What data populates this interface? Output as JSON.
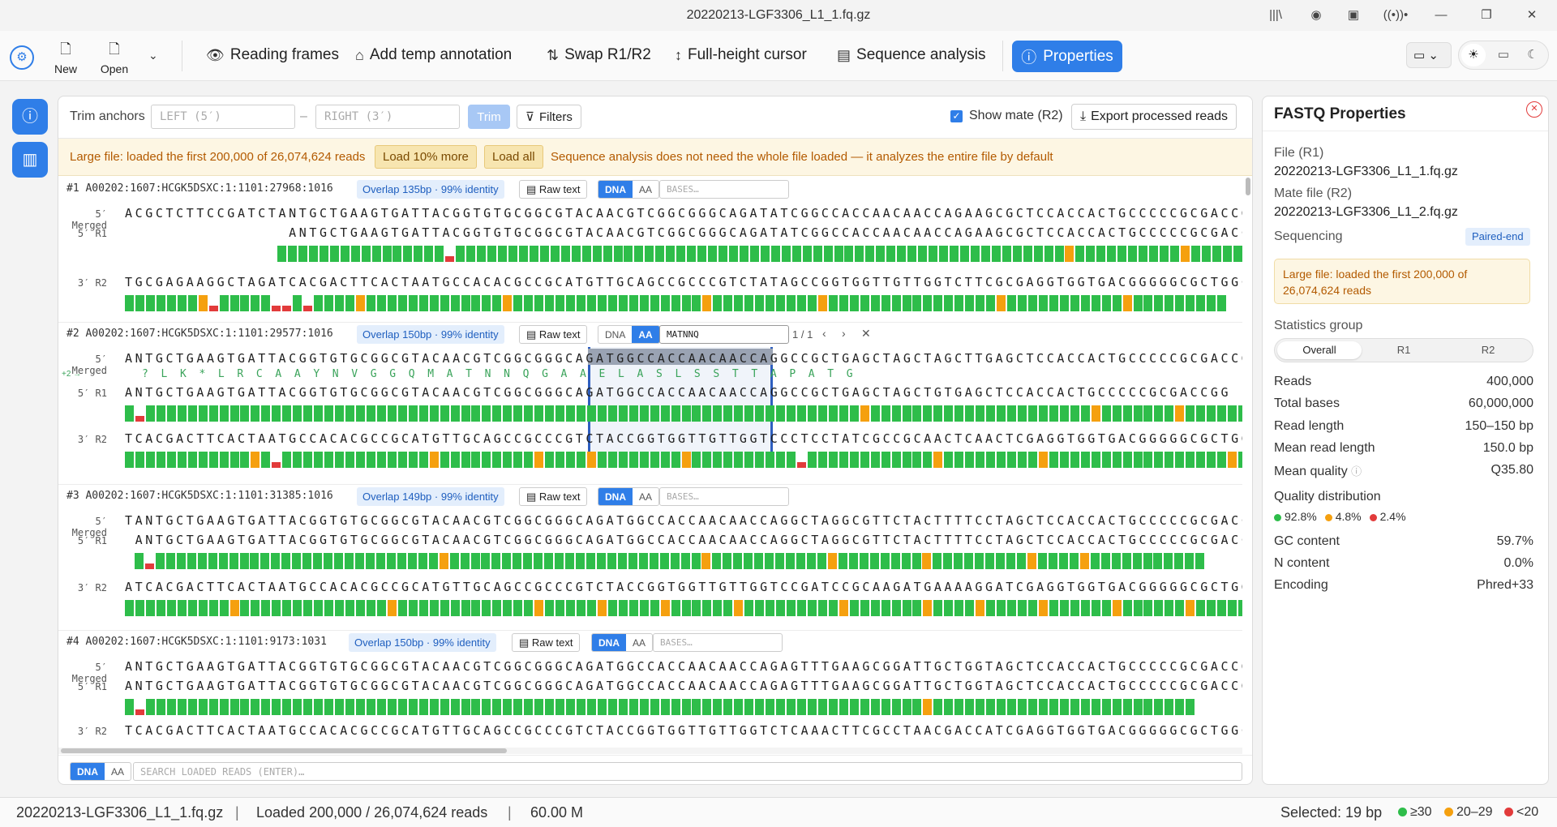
{
  "window": {
    "title": "20220213-LGF3306_L1_1.fq.gz"
  },
  "toolbar": {
    "new_label": "New",
    "open_label": "Open",
    "reading_frames": "Reading frames",
    "add_temp_annotation": "Add temp annotation",
    "swap": "Swap R1/R2",
    "full_height_cursor": "Full-height cursor",
    "sequence_analysis": "Sequence analysis",
    "properties": "Properties"
  },
  "trim": {
    "label": "Trim anchors",
    "left_placeholder": "LEFT (5′)",
    "dash": "–",
    "right_placeholder": "RIGHT (3′)",
    "trim_button": "Trim",
    "filters_button": "Filters",
    "show_mate": "Show mate (R2)",
    "export": "Export processed reads"
  },
  "banner": {
    "message": "Large file: loaded the first 200,000 of 26,074,624 reads",
    "load_more": "Load 10% more",
    "load_all": "Load all",
    "note": "Sequence analysis does not need the whole file loaded — it analyzes the entire file by default"
  },
  "read_labels": {
    "merged": "5′ Merged",
    "r1": "5′ R1",
    "r2": "3′ R2",
    "frame": "+2 →",
    "raw": "Raw text",
    "dna": "DNA",
    "aa": "AA",
    "bases_placeholder": "BASES…"
  },
  "reads": [
    {
      "id": "#1  A00202:1607:HCGK5DSXC:1:1101:27968:1016",
      "overlap": "Overlap 135bp · 99% identity",
      "merged": "ACGCTCTTCCGATCTANTGCTGAAGTGATTACGGTGTGCGGCGTACAACGTCGGCGGGCAGATATCGGCCACCAACAACCAGAAGCGCTCCACCACTGCCCCCGCGACCGG",
      "r1": "                ANTGCTGAAGTGATTACGGTGTGCGGCGTACAACGTCGGCGGGCAGATATCGGCCACCAACAACCAGAAGCGCTCCACCACTGCCCCCGCGACCGG",
      "r2": "TGCGAGAAGGCTAGATCACGACTTCACTAATGCCACACGCCGCATGTTGCAGCCGCCCGTCTATAGCCGGTGGTTGTTGGTCTTCGCGAGGTGGTGACGGGGGCGCTGGCC",
      "r1_quality": "................r..........................................................y..........y.................",
      "r2_quality": ".......yr.....rr.r....y.............y..................y..........y................y...........y........."
    },
    {
      "id": "#2  A00202:1607:HCGK5DSXC:1:1101:29577:1016",
      "overlap": "Overlap 150bp · 99% identity",
      "search_value": "MATNNQ",
      "match_count": "1 / 1",
      "merged": "ANTGCTGAAGTGATTACGGTGTGCGGCGTACAACGTCGGCGGGCAGATGGCCACCAACAACCAGGCCGCTGAGCTAGCTAGCTTGAGCTCCACCACTGCCCCCGCGACCGG",
      "translation": "?  L  K  *  L  R  C  A  A  Y  N  V  G  G  Q  M  A  T  N  N  Q  G  A  A  E  L  A  S  L  S  S  T  T  A  P  A  T  G",
      "r1": "ANTGCTGAAGTGATTACGGTGTGCGGCGTACAACGTCGGCGGGCAGATGGCCACCAACAACCAGGCCGCTGAGCTAGCTGTGAGCTCCACCACTGCCCCCGCGACCGG",
      "r2": "TCACGACTTCACTAATGCCACACGCCGCATGTTGCAGCCGCCCGTCTACCGGTGGTTGTTGGTCCCTCCTATCGCCGCAACTCAACTCGAGGTGGTGACGGGGGCGCTGGCC",
      "r1_quality": ".r....................................................................y.....................y.......y.........",
      "r2_quality": "............y.r..............y.........y....y........y..........r............y.........y.................y..."
    },
    {
      "id": "#3  A00202:1607:HCGK5DSXC:1:1101:31385:1016",
      "overlap": "Overlap 149bp · 99% identity",
      "merged": "TANTGCTGAAGTGATTACGGTGTGCGGCGTACAACGTCGGCGGGCAGATGGCCACCAACAACCAGGCTAGGCGTTCTACTTTTCCTAGCTCCACCACTGCCCCCGCGACCGG",
      "r1": " ANTGCTGAAGTGATTACGGTGTGCGGCGTACAACGTCGGCGGGCAGATGGCCACCAACAACCAGGCTAGGCGTTCTACTTTTCCTAGCTCCACCACTGCCCCCGCGACCGG",
      "r2": "ATCACGACTTCACTAATGCCACACGCCGCATGTTGCAGCCGCCCGTCTACCGGTGGTTGTTGGTCCGATCCGCAAGATGAAAAGGATCGAGGTGGTGACGGGGGCGCTGGCC",
      "r1_quality": ".r...........................y........................y...........y........y.........y....y...........",
      "r2_quality": "..........y..............y.............y.....y.....y......y.........y.......y....y.....y......y......y.........."
    },
    {
      "id": "#4  A00202:1607:HCGK5DSXC:1:1101:9173:1031",
      "overlap": "Overlap 150bp · 99% identity",
      "merged": "ANTGCTGAAGTGATTACGGTGTGCGGCGTACAACGTCGGCGGGCAGATGGCCACCAACAACCAGAGTTTGAAGCGGATTGCTGGTAGCTCCACCACTGCCCCCGCGACCGG",
      "r1": "ANTGCTGAAGTGATTACGGTGTGCGGCGTACAACGTCGGCGGGCAGATGGCCACCAACAACCAGAGTTTGAAGCGGATTGCTGGTAGCTCCACCACTGCCCCCGCGACCGG",
      "r2": "TCACGACTTCACTAATGCCACACGCCGCATGTTGCAGCCGCCCGTCTACCGGTGGTTGTTGGTCTCAAACTTCGCCTAACGACCATCGAGGTGGTGACGGGGGCGCTGGCC",
      "r1_quality": ".r..........................................................................y........................."
    }
  ],
  "search": {
    "dna": "DNA",
    "aa": "AA",
    "placeholder": "SEARCH LOADED READS (ENTER)…"
  },
  "properties": {
    "title": "FASTQ Properties",
    "file_label": "File (R1)",
    "file_value": "20220213-LGF3306_L1_1.fq.gz",
    "mate_label": "Mate file (R2)",
    "mate_value": "20220213-LGF3306_L1_2.fq.gz",
    "sequencing_label": "Sequencing",
    "sequencing_value": "Paired-end",
    "warning": "Large file: loaded the first 200,000 of 26,074,624 reads",
    "stats_group_label": "Statistics group",
    "tabs": [
      "Overall",
      "R1",
      "R2"
    ],
    "stats": [
      {
        "label": "Reads",
        "value": "400,000"
      },
      {
        "label": "Total bases",
        "value": "60,000,000"
      },
      {
        "label": "Read length",
        "value": "150–150 bp"
      },
      {
        "label": "Mean read length",
        "value": "150.0 bp"
      },
      {
        "label": "Mean quality",
        "value": "Q35.80"
      }
    ],
    "quality_label": "Quality distribution",
    "quality": [
      {
        "value": "92.8%",
        "color": "#2ebd4a"
      },
      {
        "value": "4.8%",
        "color": "#f5a00f"
      },
      {
        "value": "2.4%",
        "color": "#e23b3b"
      }
    ],
    "stats2": [
      {
        "label": "GC content",
        "value": "59.7%"
      },
      {
        "label": "N content",
        "value": "0.0%"
      },
      {
        "label": "Encoding",
        "value": "Phred+33"
      }
    ]
  },
  "status": {
    "file": "20220213-LGF3306_L1_1.fq.gz",
    "sep": "|",
    "loaded": "Loaded 200,000 / 26,074,624 reads",
    "size": "60.00 M",
    "selected": "Selected: 19 bp",
    "legend": [
      {
        "label": "≥30",
        "color": "#2ebd4a"
      },
      {
        "label": "20–29",
        "color": "#f5a00f"
      },
      {
        "label": "<20",
        "color": "#e23b3b"
      }
    ]
  },
  "colors": {
    "accent": "#2f7ee8",
    "selection": "#2f5fbf"
  }
}
